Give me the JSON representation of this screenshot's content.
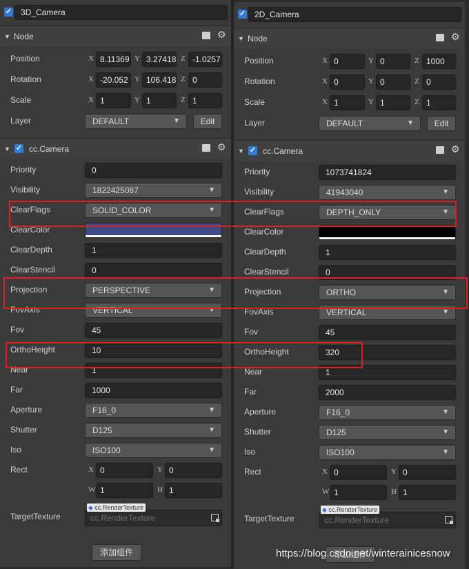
{
  "left": {
    "name": "3D_Camera",
    "node_title": "Node",
    "position": {
      "x": "8.11369",
      "y": "3.27418",
      "z": "-1.0257"
    },
    "rotation": {
      "x": "-20.052",
      "y": "106.418",
      "z": "0"
    },
    "scale": {
      "x": "1",
      "y": "1",
      "z": "1"
    },
    "layer": "DEFAULT",
    "edit": "Edit",
    "camera_title": "cc.Camera",
    "priority": "0",
    "visibility": "1822425087",
    "clearflags": "SOLID_COLOR",
    "clearcolor": "#3b4d86",
    "cleardepth": "1",
    "clearstencil": "0",
    "projection": "PERSPECTIVE",
    "fovaxis": "VERTICAL",
    "fov": "45",
    "orthoheight": "10",
    "near": "1",
    "far": "1000",
    "aperture": "F16_0",
    "shutter": "D125",
    "iso": "ISO100",
    "rect": {
      "x": "0",
      "y": "0",
      "w": "1",
      "h": "1"
    },
    "target_tag": "cc.RenderTexture",
    "target_placeholder": "cc.RenderTexture",
    "add_component": "添加组件"
  },
  "right": {
    "name": "2D_Camera",
    "node_title": "Node",
    "position": {
      "x": "0",
      "y": "0",
      "z": "1000"
    },
    "rotation": {
      "x": "0",
      "y": "0",
      "z": "0"
    },
    "scale": {
      "x": "1",
      "y": "1",
      "z": "1"
    },
    "layer": "DEFAULT",
    "edit": "Edit",
    "camera_title": "cc.Camera",
    "priority": "1073741824",
    "visibility": "41943040",
    "clearflags": "DEPTH_ONLY",
    "clearcolor": "#000000",
    "cleardepth": "1",
    "clearstencil": "0",
    "projection": "ORTHO",
    "fovaxis": "VERTICAL",
    "fov": "45",
    "orthoheight": "320",
    "near": "1",
    "far": "2000",
    "aperture": "F16_0",
    "shutter": "D125",
    "iso": "ISO100",
    "rect": {
      "x": "0",
      "y": "0",
      "w": "1",
      "h": "1"
    },
    "target_tag": "cc.RenderTexture",
    "target_placeholder": "cc.RenderTexture",
    "add_component": "添加组件"
  },
  "labels": {
    "position": "Position",
    "rotation": "Rotation",
    "scale": "Scale",
    "layer": "Layer",
    "priority": "Priority",
    "visibility": "Visibility",
    "clearflags": "ClearFlags",
    "clearcolor": "ClearColor",
    "cleardepth": "ClearDepth",
    "clearstencil": "ClearStencil",
    "projection": "Projection",
    "fovaxis": "FovAxis",
    "fov": "Fov",
    "orthoheight": "OrthoHeight",
    "near": "Near",
    "far": "Far",
    "aperture": "Aperture",
    "shutter": "Shutter",
    "iso": "Iso",
    "rect": "Rect",
    "targettexture": "TargetTexture",
    "ax_x": "X",
    "ax_y": "Y",
    "ax_z": "Z",
    "ax_w": "W",
    "ax_h": "H"
  },
  "icons": {
    "check": "checkbox-icon",
    "collapse": "triangle-down-icon",
    "help": "book-icon",
    "settings": "gear-icon",
    "dropdown": "chevron-down-icon",
    "asset": "asset-picker-icon"
  },
  "colors": {
    "highlight": "#e0201e",
    "checkbox": "#2f7bd8"
  },
  "watermark": "https://blog.csdn.net/winterainicesnow"
}
